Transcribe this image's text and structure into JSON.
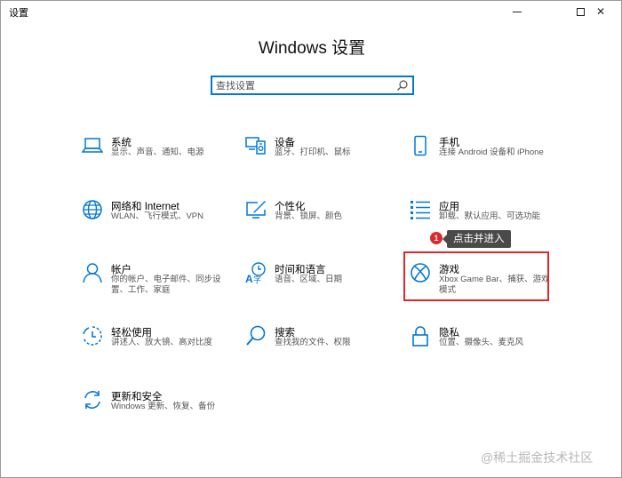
{
  "window": {
    "title": "设置",
    "page_title": "Windows 设置"
  },
  "search": {
    "placeholder": "查找设置"
  },
  "tiles": [
    {
      "name": "系统",
      "desc": "显示、声音、通知、电源",
      "icon": "laptop-icon"
    },
    {
      "name": "设备",
      "desc": "蓝牙、打印机、鼠标",
      "icon": "devices-icon"
    },
    {
      "name": "手机",
      "desc": "连接 Android 设备和 iPhone",
      "icon": "phone-icon"
    },
    {
      "name": "网络和 Internet",
      "desc": "WLAN、飞行模式、VPN",
      "icon": "globe-icon"
    },
    {
      "name": "个性化",
      "desc": "背景、锁屏、颜色",
      "icon": "paintbrush-icon"
    },
    {
      "name": "应用",
      "desc": "卸载、默认应用、可选功能",
      "icon": "apps-list-icon"
    },
    {
      "name": "帐户",
      "desc": "你的帐户、电子邮件、同步设置、工作、家庭",
      "icon": "person-icon"
    },
    {
      "name": "时间和语言",
      "desc": "语音、区域、日期",
      "icon": "time-language-icon"
    },
    {
      "name": "游戏",
      "desc": "Xbox Game Bar、捕获、游戏模式",
      "icon": "xbox-icon"
    },
    {
      "name": "轻松使用",
      "desc": "讲述人、放大镜、高对比度",
      "icon": "ease-of-access-icon"
    },
    {
      "name": "搜索",
      "desc": "查找我的文件、权限",
      "icon": "search-magnifier-icon"
    },
    {
      "name": "隐私",
      "desc": "位置、摄像头、麦克风",
      "icon": "lock-icon"
    },
    {
      "name": "更新和安全",
      "desc": "Windows 更新、恢复、备份",
      "icon": "update-icon"
    }
  ],
  "annotation": {
    "badge": "1",
    "tooltip": "点击并进入"
  },
  "watermark": "@稀土掘金技术社区",
  "colors": {
    "accent": "#0078d7",
    "highlight": "#e0282a"
  }
}
